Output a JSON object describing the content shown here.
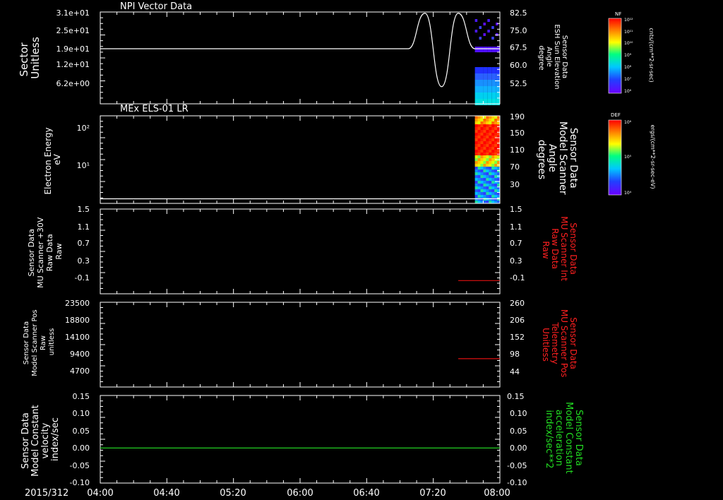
{
  "figure": {
    "date_label": "2015/312",
    "time_ticks": [
      "04:00",
      "04:40",
      "05:20",
      "06:00",
      "06:40",
      "07:20",
      "08:00"
    ]
  },
  "colors": {
    "background": "#000000",
    "axis": "#ffffff",
    "trace_white": "#ffffff",
    "trace_red": "#dd1111",
    "trace_green": "#22cc22",
    "label_red": "#ff2020",
    "label_green": "#22dd22"
  },
  "panels": [
    {
      "id": "npi-vector",
      "title": "NPI Vector Data",
      "left_label": [
        "Sector",
        "Unitless"
      ],
      "right_label": [
        "Sensor Data",
        "ESH Sun Elevation",
        "Angle",
        "degree"
      ],
      "left_ticks": [
        "3.1e+01",
        "2.5e+01",
        "1.9e+01",
        "1.2e+01",
        "6.2e+00"
      ],
      "right_ticks": [
        "82.5",
        "75.0",
        "67.5",
        "60.0",
        "52.5"
      ],
      "colorbar": {
        "title": "NF",
        "ticks": [
          "10¹²",
          "10¹¹",
          "10¹⁰",
          "10⁹",
          "10⁸",
          "10⁷",
          "10⁶"
        ],
        "unit": "cnts/(cm**2-sr-sec)"
      }
    },
    {
      "id": "mex-els",
      "title": "MEx ELS-01 LR",
      "left_label": [
        "Electron Energy",
        "eV"
      ],
      "right_label": [
        "Sensor Data",
        "Model Scanner",
        "Angle",
        "degrees"
      ],
      "left_ticks": [
        "10²",
        "10¹"
      ],
      "right_ticks": [
        "190",
        "150",
        "110",
        "70",
        "30"
      ],
      "colorbar": {
        "title": "DEF",
        "ticks": [
          "10⁶",
          "10⁵",
          "10⁴"
        ],
        "unit": "ergs/(cm**2-sr-sec-eV)"
      }
    },
    {
      "id": "mu-scanner-30v",
      "title": "",
      "left_label": [
        "Sensor Data",
        "MU Scanner +30V",
        "Raw Data",
        "Raw"
      ],
      "right_label": [
        "Sensor Data",
        "MU Scanner Int",
        "Raw Data",
        "Raw"
      ],
      "left_ticks": [
        "1.5",
        "1.1",
        "0.7",
        "0.3",
        "-0.1"
      ],
      "right_ticks": [
        "1.5",
        "1.1",
        "0.7",
        "0.3",
        "-0.1"
      ]
    },
    {
      "id": "model-scanner-pos",
      "title": "",
      "left_label": [
        "Sensor Data",
        "Model Scanner Pos",
        "Raw",
        "unitless"
      ],
      "right_label": [
        "Sensor Data",
        "MU Scanner Pos",
        "Telemetry",
        "Unitless"
      ],
      "left_ticks": [
        "23500",
        "18800",
        "14100",
        "9400",
        "4700"
      ],
      "right_ticks": [
        "260",
        "206",
        "152",
        "98",
        "44"
      ]
    },
    {
      "id": "model-constant",
      "title": "",
      "left_label": [
        "Sensor Data",
        "Model Constant",
        "velocity",
        "index/sec"
      ],
      "right_label": [
        "Sensor Data",
        "Model Constant",
        "acceleration",
        "index/sec**2"
      ],
      "left_ticks": [
        "0.15",
        "0.10",
        "0.05",
        "0.00",
        "-0.05",
        "-0.10"
      ],
      "right_ticks": [
        "0.15",
        "0.10",
        "0.05",
        "0.00",
        "-0.05",
        "-0.10"
      ]
    }
  ],
  "chart_data": [
    {
      "type": "line",
      "panel": "npi-vector",
      "title": "NPI Vector Data",
      "x": [
        "04:00",
        "07:05",
        "07:15",
        "07:25",
        "07:35",
        "07:45",
        "07:50",
        "08:00"
      ],
      "series": [
        {
          "name": "ESH Sun Elevation Angle",
          "axis": "right",
          "color": "#ffffff",
          "values": [
            67.5,
            67.5,
            82.0,
            52.0,
            82.0,
            67.5,
            67.5,
            67.5
          ]
        }
      ],
      "ylim_right": [
        45.0,
        82.5
      ],
      "spectrogram_start": "07:45"
    },
    {
      "type": "heatmap",
      "panel": "mex-els",
      "title": "MEx ELS-01 LR",
      "ylabel": "Electron Energy eV",
      "spectrogram_start": "07:45",
      "series": [
        {
          "name": "Model Scanner Angle",
          "axis": "right",
          "color": "#ffffff",
          "x": [
            "04:00",
            "08:00"
          ],
          "values": [
            10,
            10
          ]
        }
      ],
      "ylim_right": [
        0,
        190
      ]
    },
    {
      "type": "line",
      "panel": "mu-scanner-30v",
      "series": [
        {
          "name": "MU Scanner Int Raw Data",
          "axis": "right",
          "color": "#dd1111",
          "x": [
            "07:35",
            "08:00"
          ],
          "values": [
            -0.02,
            -0.02
          ]
        }
      ],
      "ylim": [
        -0.3,
        1.5
      ]
    },
    {
      "type": "line",
      "panel": "model-scanner-pos",
      "series": [
        {
          "name": "MU Scanner Pos Telemetry",
          "axis": "right",
          "color": "#dd1111",
          "x": [
            "07:35",
            "08:00"
          ],
          "values": [
            87,
            87
          ]
        }
      ],
      "ylim_right": [
        0,
        260
      ]
    },
    {
      "type": "line",
      "panel": "model-constant",
      "series": [
        {
          "name": "Model Constant acceleration",
          "axis": "right",
          "color": "#22cc22",
          "x": [
            "04:00",
            "08:00"
          ],
          "values": [
            0.0,
            0.0
          ]
        }
      ],
      "ylim": [
        -0.1,
        0.15
      ]
    }
  ]
}
